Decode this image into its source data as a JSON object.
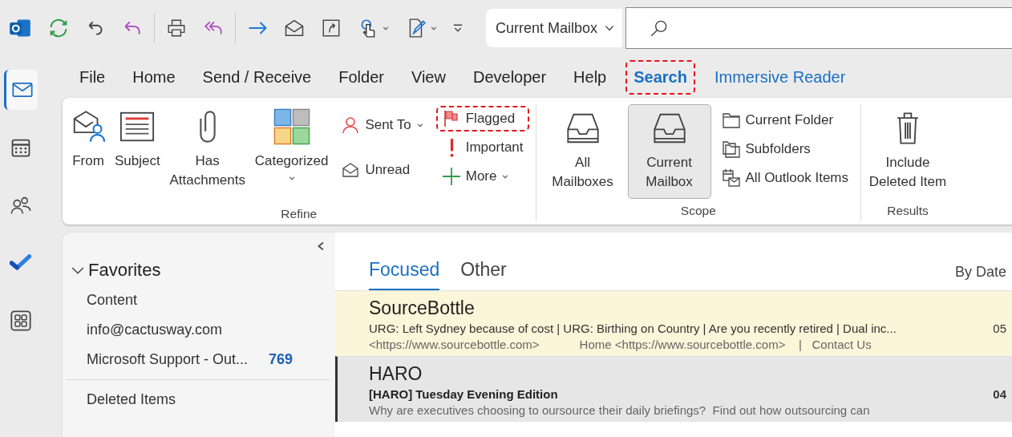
{
  "toolbar": {
    "scope_dropdown": "Current Mailbox"
  },
  "nav_rail": [
    {
      "selected": true
    },
    {
      "selected": false
    },
    {
      "selected": false
    },
    {
      "selected": false
    },
    {
      "selected": false
    }
  ],
  "ribbon_tabs": [
    {
      "label": "File",
      "selected": false,
      "kind": "standard"
    },
    {
      "label": "Home",
      "selected": false,
      "kind": "standard"
    },
    {
      "label": "Send / Receive",
      "selected": false,
      "kind": "standard"
    },
    {
      "label": "Folder",
      "selected": false,
      "kind": "standard"
    },
    {
      "label": "View",
      "selected": false,
      "kind": "standard"
    },
    {
      "label": "Developer",
      "selected": false,
      "kind": "standard"
    },
    {
      "label": "Help",
      "selected": false,
      "kind": "standard"
    },
    {
      "label": "Search",
      "selected": true,
      "kind": "contextual",
      "highlighted": true
    },
    {
      "label": "Immersive Reader",
      "selected": false,
      "kind": "contextual"
    }
  ],
  "ribbon_groups": [
    {
      "label": "Refine",
      "items": [
        {
          "kind": "large",
          "label": "From"
        },
        {
          "kind": "large",
          "label": "Subject"
        },
        {
          "kind": "large",
          "label": "Has Attachments"
        },
        {
          "kind": "large",
          "label": "Categorized",
          "dropdown": true
        },
        {
          "kind": "column",
          "items": [
            {
              "label": "Sent To",
              "dropdown": true
            },
            {
              "label": "Unread"
            }
          ]
        },
        {
          "kind": "column",
          "items": [
            {
              "label": "Flagged",
              "highlighted": true
            },
            {
              "label": "Important"
            },
            {
              "label": "More",
              "dropdown": true
            }
          ]
        }
      ]
    },
    {
      "label": "Scope",
      "items": [
        {
          "kind": "large",
          "label": "All Mailboxes",
          "selected": false
        },
        {
          "kind": "large",
          "label": "Current Mailbox",
          "selected": true
        },
        {
          "kind": "column",
          "items": [
            {
              "label": "Current Folder"
            },
            {
              "label": "Subfolders"
            },
            {
              "label": "All Outlook Items"
            }
          ]
        }
      ]
    },
    {
      "label": "Results",
      "items": [
        {
          "kind": "large",
          "label": "Include Deleted Item"
        }
      ]
    }
  ],
  "folder_pane": {
    "favorites": {
      "label": "Favorites",
      "expanded": true,
      "items": [
        {
          "label": "Content"
        },
        {
          "label": "info@cactusway.com"
        },
        {
          "label": "Microsoft Support - Out...",
          "count": "769"
        }
      ]
    },
    "folders": [
      {
        "label": "Deleted Items"
      }
    ]
  },
  "message_list": {
    "tabs": [
      {
        "label": "Focused",
        "selected": true
      },
      {
        "label": "Other",
        "selected": false
      }
    ],
    "sort": "By Date",
    "messages": [
      {
        "sender": "SourceBottle",
        "subject": "URG: Left Sydney because of cost | URG: Birthing on Country | Are you recently retired | Dual inc...",
        "preview": "<https://www.sourcebottle.com>            Home <https://www.sourcebottle.com>    |   Contact Us",
        "date": "05",
        "selected": true,
        "unread": false
      },
      {
        "sender": "HARO",
        "subject": "[HARO] Tuesday Evening Edition",
        "preview": "Why are executives choosing to oursource their daily briefings?  Find out how outsourcing can",
        "date": "04",
        "selected": false,
        "unread": true
      }
    ]
  }
}
